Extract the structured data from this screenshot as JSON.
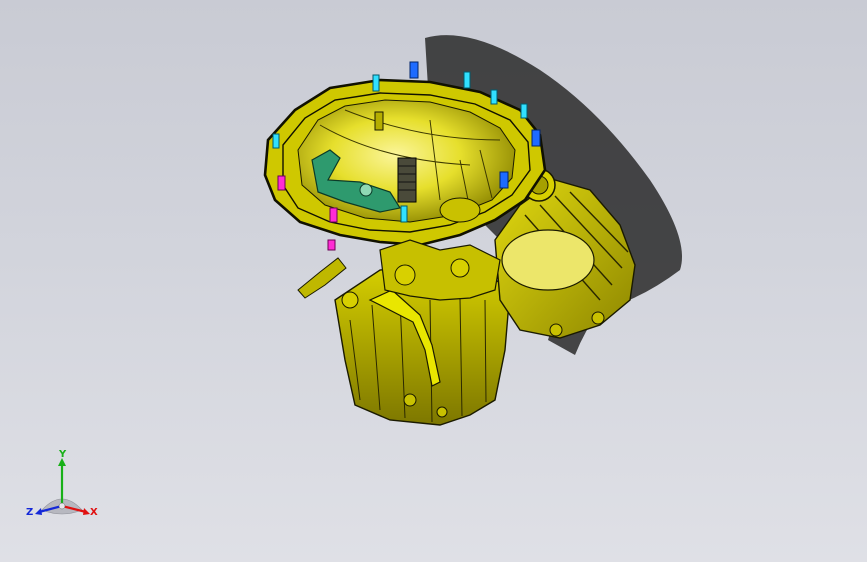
{
  "viewport": {
    "background_top": "#c9cbd4",
    "background_bottom": "#dfe0e6"
  },
  "model": {
    "body_color": "#d8d000",
    "edge_color": "#1a1a00",
    "bolt_colors": [
      "#31e0ff",
      "#1e6bff",
      "#ff2bd4"
    ],
    "lever_color": "#2e9a6e"
  },
  "triad": {
    "x_label": "X",
    "y_label": "Y",
    "z_label": "Z",
    "x_color": "#e01010",
    "y_color": "#18b018",
    "z_color": "#1428d8"
  }
}
